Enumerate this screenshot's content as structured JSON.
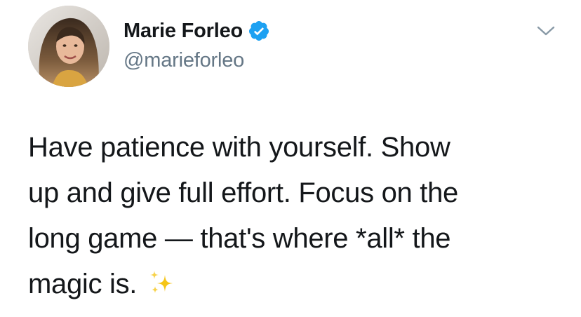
{
  "tweet": {
    "author": {
      "display_name": "Marie Forleo",
      "handle": "@marieforleo",
      "verified": true,
      "verified_icon": "verified-badge-icon",
      "verified_color": "#1da1f2"
    },
    "menu_icon": "chevron-down-icon",
    "text_lines": [
      "Have patience with yourself. Show",
      "up and give full effort. Focus on the",
      "long game — that's where *all* the",
      "magic is."
    ],
    "emoji": "sparkles-icon",
    "colors": {
      "text": "#14171a",
      "secondary": "#657786",
      "sparkle": "#f5c518"
    }
  }
}
